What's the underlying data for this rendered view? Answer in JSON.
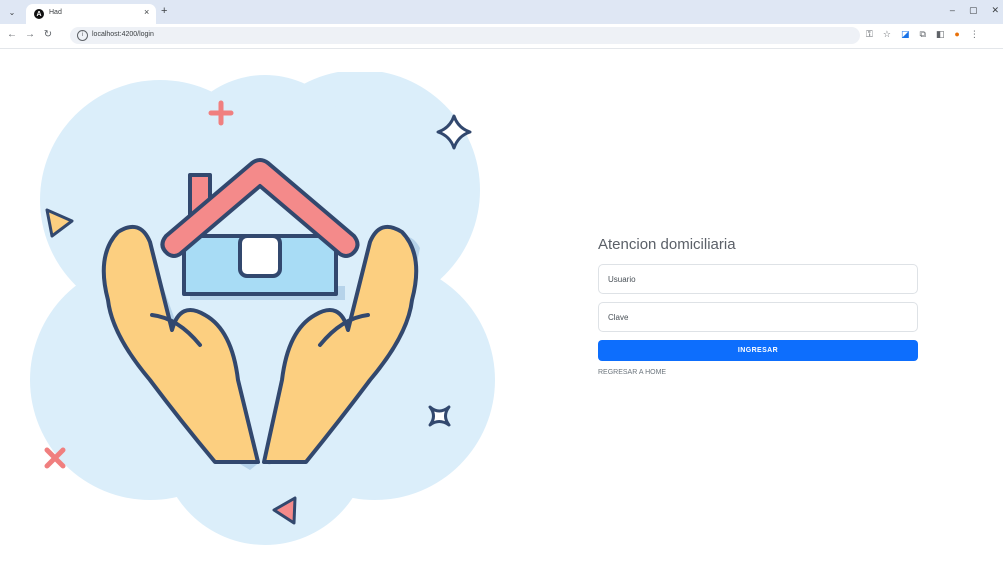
{
  "browser": {
    "tab_title": "Had",
    "tab_close": "×",
    "new_tab": "+",
    "url": "localhost:4200/login",
    "icons": [
      "tab-search-icon",
      "back-icon",
      "forward-icon",
      "reload-icon",
      "site-info-icon",
      "password-key-icon",
      "bookmark-star-icon",
      "extension-icon",
      "extensions-puzzle-icon",
      "side-panel-icon",
      "profile-icon",
      "menu-icon"
    ],
    "window_controls": [
      "–",
      "▢",
      "✕"
    ]
  },
  "login": {
    "title": "Atencion domiciliaria",
    "username_placeholder": "Usuario",
    "password_placeholder": "Clave",
    "submit_label": "INGRESAR",
    "home_link": "REGRESAR A HOME"
  },
  "colors": {
    "primary": "#0d6efd",
    "blob": "#dbeefa",
    "roof": "#f48a8a",
    "house": "#a8dcf5",
    "hands": "#fccf80",
    "outline": "#32486e"
  }
}
